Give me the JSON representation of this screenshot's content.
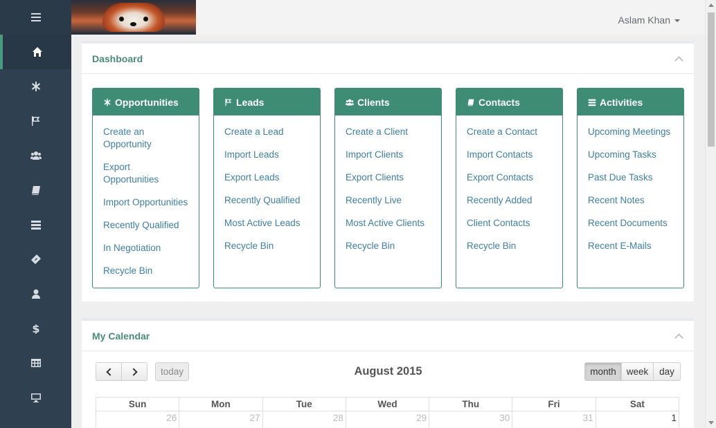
{
  "sidebar": {
    "items": [
      {
        "icon": "home-icon",
        "active": true
      },
      {
        "icon": "asterisk-icon"
      },
      {
        "icon": "flag-icon"
      },
      {
        "icon": "users-icon"
      },
      {
        "icon": "book-icon"
      },
      {
        "icon": "list-icon"
      },
      {
        "icon": "ticket-icon"
      },
      {
        "icon": "user-icon"
      },
      {
        "icon": "dollar-icon"
      },
      {
        "icon": "table-icon"
      },
      {
        "icon": "monitor-icon"
      }
    ]
  },
  "header": {
    "user_name": "Aslam Khan"
  },
  "dashboard": {
    "title": "Dashboard",
    "cards": [
      {
        "title": "Opportunities",
        "icon": "asterisk-icon",
        "links": [
          "Create an Opportunity",
          "Export Opportunities",
          "Import Opportunities",
          "Recently Qualified",
          "In Negotiation",
          "Recycle Bin"
        ]
      },
      {
        "title": "Leads",
        "icon": "flag-icon",
        "links": [
          "Create a Lead",
          "Import Leads",
          "Export Leads",
          "Recently Qualified",
          "Most Active Leads",
          "Recycle Bin"
        ]
      },
      {
        "title": "Clients",
        "icon": "users-icon",
        "links": [
          "Create a Client",
          "Import Clients",
          "Export Clients",
          "Recently Live",
          "Most Active Clients",
          "Recycle Bin"
        ]
      },
      {
        "title": "Contacts",
        "icon": "book-icon",
        "links": [
          "Create a Contact",
          "Import Contacts",
          "Export Contacts",
          "Recently Added",
          "Client Contacts",
          "Recycle Bin"
        ]
      },
      {
        "title": "Activities",
        "icon": "list-icon",
        "links": [
          "Upcoming Meetings",
          "Upcoming Tasks",
          "Past Due Tasks",
          "Recent Notes",
          "Recent Documents",
          "Recent E-Mails"
        ]
      }
    ]
  },
  "calendar": {
    "title": "My Calendar",
    "month_label": "August 2015",
    "today_label": "today",
    "views": {
      "month": "month",
      "week": "week",
      "day": "day"
    },
    "weekdays": [
      "Sun",
      "Mon",
      "Tue",
      "Wed",
      "Thu",
      "Fri",
      "Sat"
    ],
    "first_week": [
      {
        "day": "26",
        "current_month": false
      },
      {
        "day": "27",
        "current_month": false
      },
      {
        "day": "28",
        "current_month": false
      },
      {
        "day": "29",
        "current_month": false
      },
      {
        "day": "30",
        "current_month": false
      },
      {
        "day": "31",
        "current_month": false
      },
      {
        "day": "1",
        "current_month": true
      }
    ]
  },
  "colors": {
    "sidebar": "#2f4050",
    "accent": "#3d8c73",
    "link": "#3d7fa6"
  }
}
